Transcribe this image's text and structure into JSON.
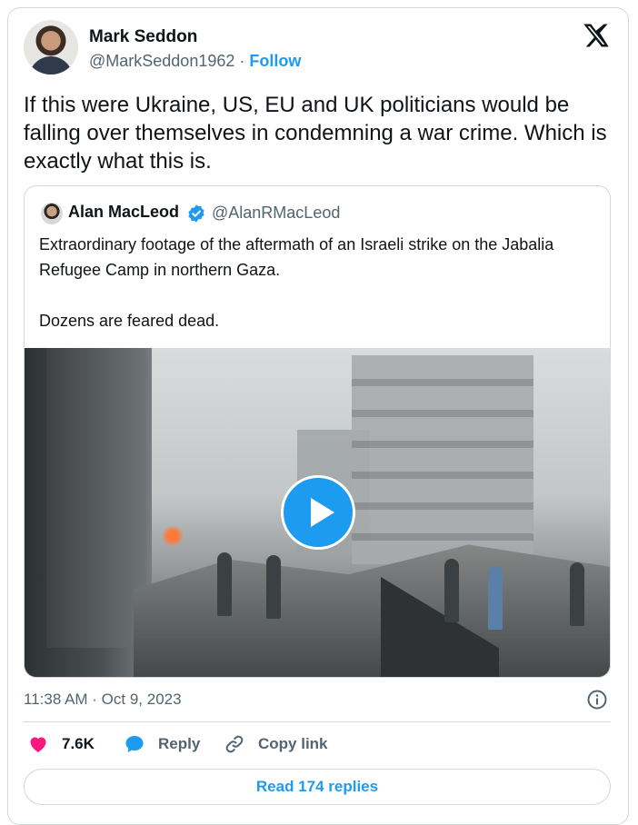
{
  "author": {
    "name": "Mark Seddon",
    "handle": "@MarkSeddon1962",
    "separator": "·",
    "follow_label": "Follow"
  },
  "tweet": {
    "text": "If this were Ukraine, US, EU and UK politicians would be falling over themselves in condemning a war crime. Which is exactly what this is.",
    "timestamp": "11:38 AM · Oct 9, 2023"
  },
  "quoted": {
    "name": "Alan MacLeod",
    "handle": "@AlanRMacLeod",
    "text": "Extraordinary footage of the aftermath of an Israeli strike on the Jabalia Refugee Camp in northern Gaza.\n\nDozens are feared dead.",
    "verified_icon": "verified-badge-icon",
    "media_icon": "play-icon"
  },
  "actions": {
    "likes": "7.6K",
    "reply_label": "Reply",
    "copy_link_label": "Copy link",
    "read_replies_label": "Read 174 replies"
  },
  "colors": {
    "accent": "#1d9bf0",
    "like": "#f91880",
    "muted": "#536471",
    "border": "#cfd9de"
  }
}
